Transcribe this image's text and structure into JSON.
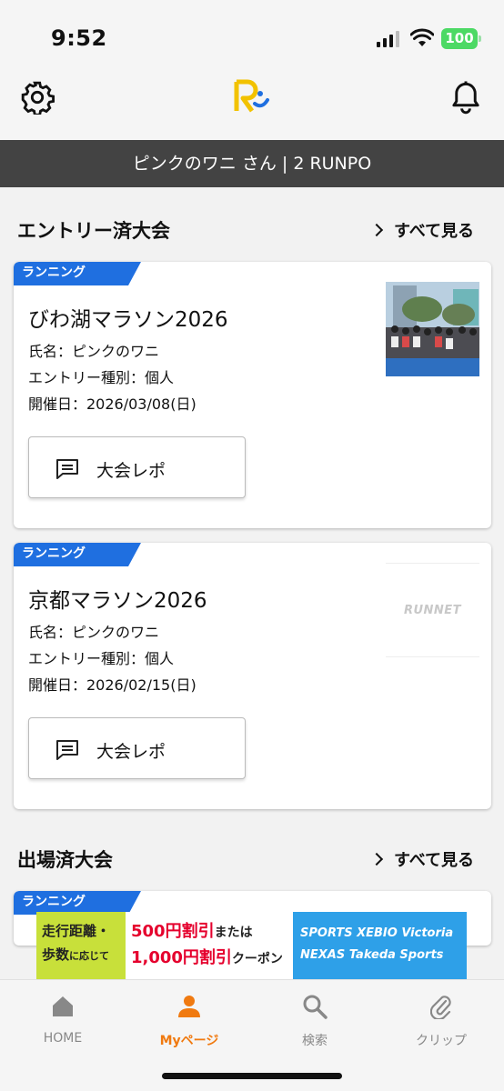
{
  "status_bar": {
    "time": "9:52",
    "battery": "100"
  },
  "header": {
    "settings_icon": "gear-icon",
    "logo_icon": "runnet-logo-icon",
    "bell_icon": "bell-icon"
  },
  "user_bar": {
    "text": "ピンクのワニ さん | 2 RUNPO"
  },
  "entered": {
    "title": "エントリー済大会",
    "see_all": "すべて見る",
    "cards": [
      {
        "tag": "ランニング",
        "name": "びわ湖マラソン2026",
        "person": "氏名：ピンクのワニ",
        "entry_type": "エントリー種別：個人",
        "date": "開催日：2026/03/08(日)",
        "button": "大会レポ"
      },
      {
        "tag": "ランニング",
        "name": "京都マラソン2026",
        "person": "氏名：ピンクのワニ",
        "entry_type": "エントリー種別：個人",
        "date": "開催日：2026/02/15(日)",
        "button": "大会レポ",
        "placeholder_logo": "RUNNET"
      }
    ]
  },
  "participated": {
    "title": "出場済大会",
    "see_all": "すべて見る",
    "cards": [
      {
        "tag": "ランニング"
      }
    ]
  },
  "ad": {
    "left_line1": "走行距離・",
    "left_line2": "歩数",
    "left_small": "に応じて",
    "mid_line1": "500円割引",
    "mid_line1b": "または",
    "mid_line2": "1,000円割引",
    "mid_line2b": "クーポン",
    "right_line1": "SPORTS XEBIO  Victoria",
    "right_line2": "NEXAS  Takeda Sports"
  },
  "tabbar": {
    "tabs": [
      {
        "label": "HOME",
        "icon": "home-icon"
      },
      {
        "label": "Myページ",
        "icon": "person-icon"
      },
      {
        "label": "検索",
        "icon": "search-icon"
      },
      {
        "label": "クリップ",
        "icon": "paperclip-icon"
      }
    ],
    "active_color": "#f07a10"
  }
}
